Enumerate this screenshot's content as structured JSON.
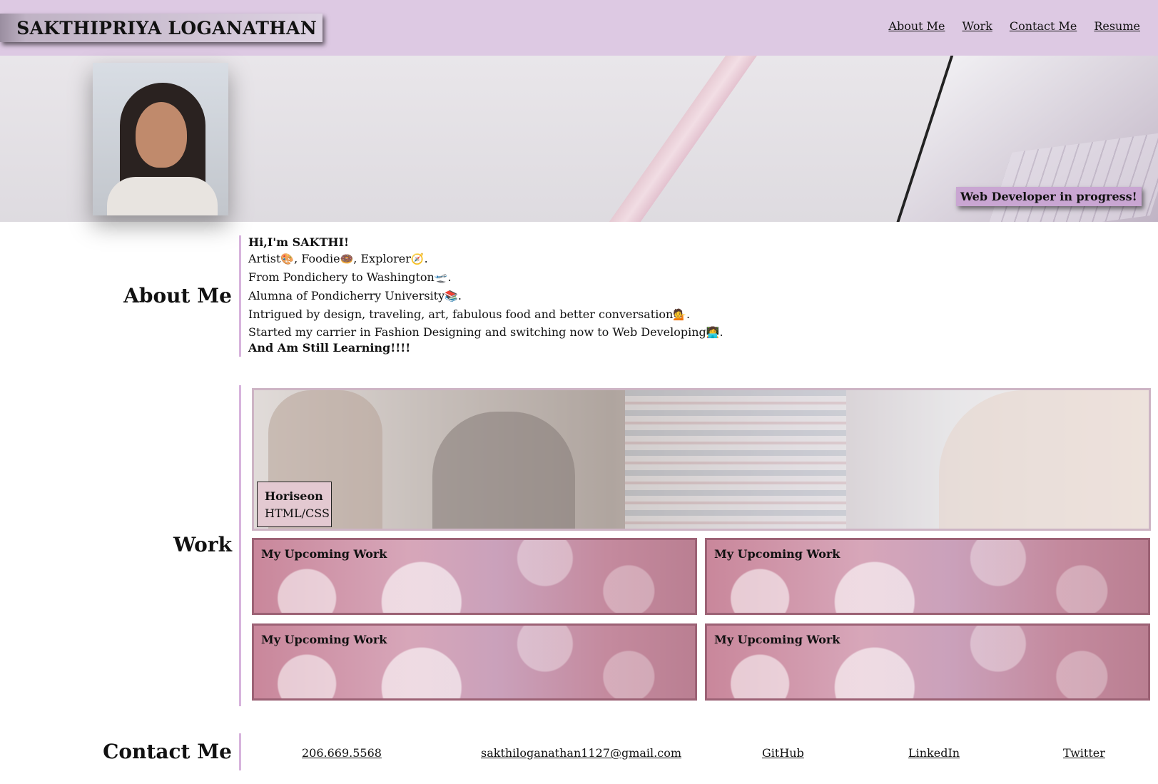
{
  "header": {
    "title": "SAKTHIPRIYA LOGANATHAN",
    "nav": [
      "About Me",
      "Work",
      "Contact Me",
      "Resume"
    ]
  },
  "hero": {
    "tagline": "Web Developer in progress!"
  },
  "about": {
    "heading": "About Me",
    "greeting": "Hi,I'm SAKTHI!",
    "lines": [
      {
        "text": "Artist",
        "emoji": "🎨",
        "rest": ", Foodie",
        "emoji2": "🍩",
        "rest2": ", Explorer",
        "emoji3": "🧭",
        "end": "."
      },
      {
        "text": "From Pondichery to Washington",
        "emoji": "🛫",
        "end": "."
      },
      {
        "text": "Alumna of Pondicherry University",
        "emoji": "📚",
        "end": "."
      },
      {
        "text": "Intrigued by design, traveling, art, fabulous food and better conversation",
        "emoji": "💁",
        "end": "."
      },
      {
        "text": "Started my carrier in Fashion Designing and switching now to Web Developing",
        "emoji": "👩‍💻",
        "end": "."
      }
    ],
    "closing": "And Am Still Learning!!!!"
  },
  "work": {
    "heading": "Work",
    "featured": {
      "title": "Horiseon",
      "subtitle": "HTML/CSS"
    },
    "upcoming": [
      "My Upcoming Work",
      "My Upcoming Work",
      "My Upcoming Work",
      "My Upcoming Work"
    ]
  },
  "contact": {
    "heading": "Contact Me",
    "phone": "206.669.5568",
    "email": "sakthiloganathan1127@gmail.com",
    "github": "GitHub",
    "linkedin": "LinkedIn",
    "twitter": "Twitter"
  },
  "colors": {
    "header_bg": "#ddc9e3",
    "accent_line": "#d7b3dc",
    "tile_border": "#9c6275",
    "label_bg": "#e3c9d1"
  }
}
